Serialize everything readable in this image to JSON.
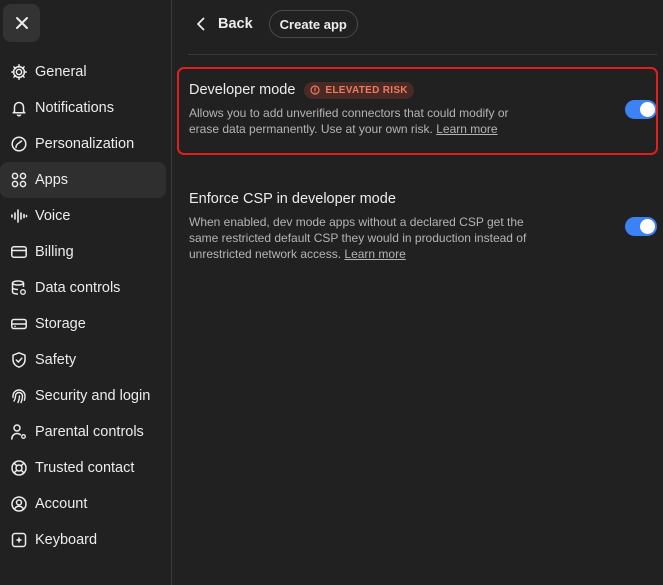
{
  "sidebar": {
    "close_icon": "close-icon",
    "items": [
      {
        "label": "General",
        "icon": "gear-icon"
      },
      {
        "label": "Notifications",
        "icon": "bell-icon"
      },
      {
        "label": "Personalization",
        "icon": "personalization-icon"
      },
      {
        "label": "Apps",
        "icon": "apps-grid-icon",
        "active": true
      },
      {
        "label": "Voice",
        "icon": "waveform-icon"
      },
      {
        "label": "Billing",
        "icon": "credit-card-icon"
      },
      {
        "label": "Data controls",
        "icon": "database-icon"
      },
      {
        "label": "Storage",
        "icon": "storage-icon"
      },
      {
        "label": "Safety",
        "icon": "shield-icon"
      },
      {
        "label": "Security and login",
        "icon": "fingerprint-icon"
      },
      {
        "label": "Parental controls",
        "icon": "parental-icon"
      },
      {
        "label": "Trusted contact",
        "icon": "lifebuoy-icon"
      },
      {
        "label": "Account",
        "icon": "account-icon"
      },
      {
        "label": "Keyboard",
        "icon": "keyboard-icon"
      }
    ]
  },
  "header": {
    "back_label": "Back",
    "create_app_label": "Create app"
  },
  "settings": [
    {
      "title": "Developer mode",
      "badge": "ELEVATED RISK",
      "description": "Allows you to add unverified connectors that could modify or erase data permanently. Use at your own risk.",
      "link": "Learn more",
      "enabled": true
    },
    {
      "title": "Enforce CSP in developer mode",
      "description": "When enabled, dev mode apps without a declared CSP get the same restricted default CSP they would in production instead of unrestricted network access.",
      "link": "Learn more",
      "enabled": true
    }
  ],
  "colors": {
    "background": "#212121",
    "toggle_on": "#3b82f6",
    "risk_badge_text": "#f07a5e",
    "risk_badge_bg": "#4a2a24",
    "highlight_border": "#e0201e"
  }
}
